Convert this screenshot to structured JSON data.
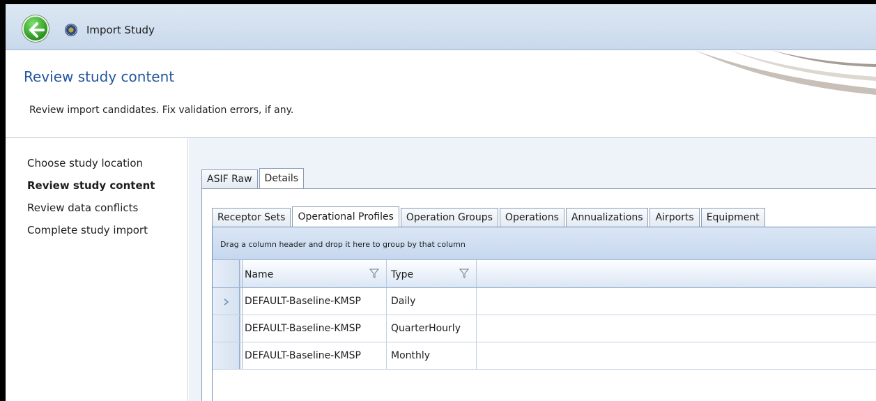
{
  "window": {
    "title": "Import Study"
  },
  "header": {
    "title": "Review study content",
    "subtitle": "Review import candidates. Fix validation errors, if any."
  },
  "nav": {
    "items": [
      {
        "label": "Choose study location",
        "active": false
      },
      {
        "label": "Review study content",
        "active": true
      },
      {
        "label": "Review data conflicts",
        "active": false
      },
      {
        "label": "Complete study import",
        "active": false
      }
    ]
  },
  "outer_tabs": [
    {
      "label": "ASIF Raw",
      "selected": false
    },
    {
      "label": "Details",
      "selected": true
    }
  ],
  "inner_tabs": [
    {
      "label": "Receptor Sets",
      "selected": false
    },
    {
      "label": "Operational Profiles",
      "selected": true
    },
    {
      "label": "Operation Groups",
      "selected": false
    },
    {
      "label": "Operations",
      "selected": false
    },
    {
      "label": "Annualizations",
      "selected": false
    },
    {
      "label": "Airports",
      "selected": false
    },
    {
      "label": "Equipment",
      "selected": false
    }
  ],
  "grid": {
    "group_hint": "Drag a column header and drop it here to group by that column",
    "columns": [
      "Name",
      "Type"
    ],
    "rows": [
      {
        "name": "DEFAULT-Baseline-KMSP",
        "type": "Daily",
        "current": true
      },
      {
        "name": "DEFAULT-Baseline-KMSP",
        "type": "QuarterHourly",
        "current": false
      },
      {
        "name": "DEFAULT-Baseline-KMSP",
        "type": "Monthly",
        "current": false
      }
    ]
  },
  "colors": {
    "accent": "#23569e",
    "titlebar": "#c9d9ec",
    "grid_header": "#c6d7ee"
  }
}
